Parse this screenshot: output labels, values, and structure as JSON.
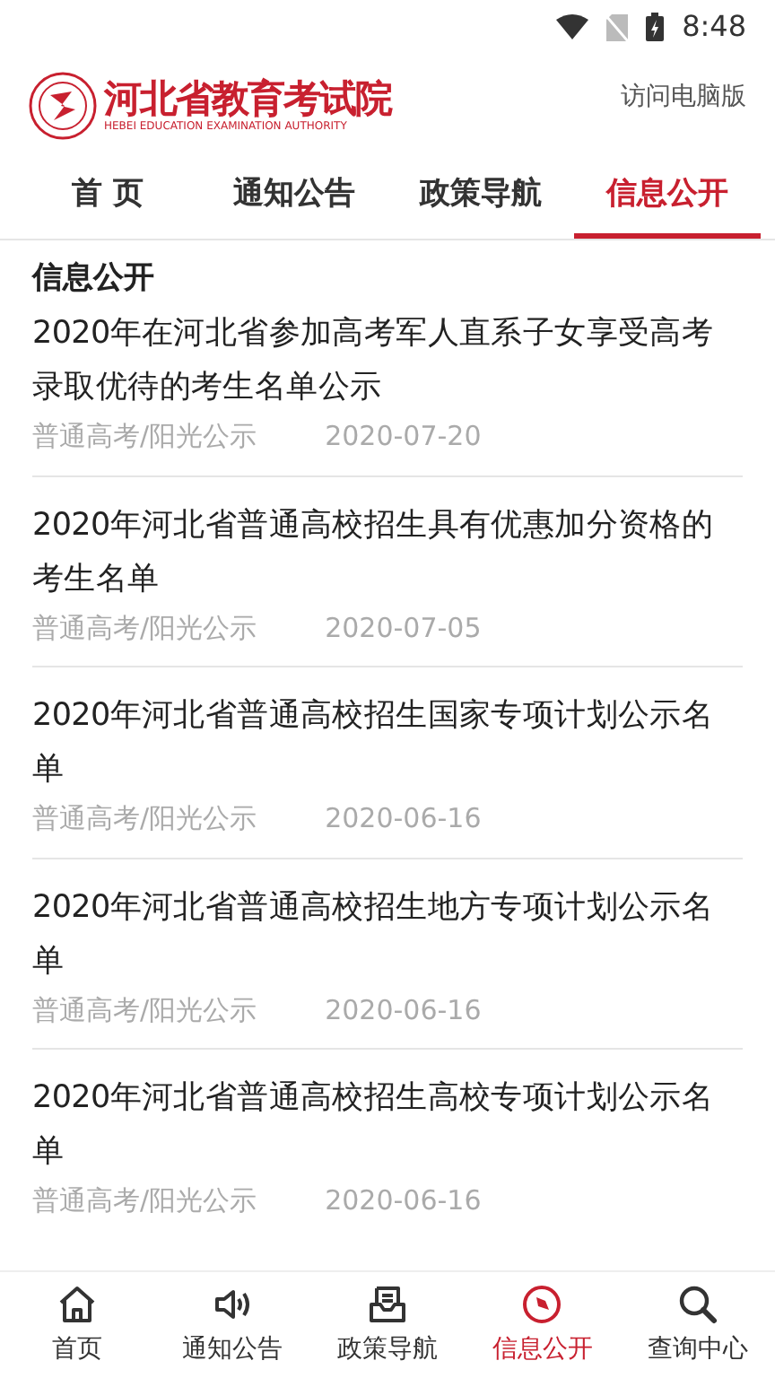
{
  "status_bar": {
    "time": "8:48"
  },
  "header": {
    "logo_title": "河北省教育考试院",
    "logo_subtitle": "HEBEI EDUCATION EXAMINATION AUTHORITY",
    "desktop_link": "访问电脑版"
  },
  "tabs": [
    {
      "label": "首 页",
      "selected": false
    },
    {
      "label": "通知公告",
      "selected": false
    },
    {
      "label": "政策导航",
      "selected": false
    },
    {
      "label": "信息公开",
      "selected": true
    }
  ],
  "section_title": "信息公开",
  "articles": [
    {
      "title": "2020年在河北省参加高考军人直系子女享受高考录取优待的考生名单公示",
      "category": "普通高考/阳光公示",
      "date": "2020-07-20"
    },
    {
      "title": "2020年河北省普通高校招生具有优惠加分资格的考生名单",
      "category": "普通高考/阳光公示",
      "date": "2020-07-05"
    },
    {
      "title": "2020年河北省普通高校招生国家专项计划公示名单",
      "category": "普通高考/阳光公示",
      "date": "2020-06-16"
    },
    {
      "title": "2020年河北省普通高校招生地方专项计划公示名单",
      "category": "普通高考/阳光公示",
      "date": "2020-06-16"
    },
    {
      "title": "2020年河北省普通高校招生高校专项计划公示名单",
      "category": "普通高考/阳光公示",
      "date": "2020-06-16"
    }
  ],
  "bottom_nav": [
    {
      "kind": "home",
      "label": "首页",
      "selected": false
    },
    {
      "kind": "speaker",
      "label": "通知公告",
      "selected": false
    },
    {
      "kind": "inbox",
      "label": "政策导航",
      "selected": false
    },
    {
      "kind": "compass",
      "label": "信息公开",
      "selected": true
    },
    {
      "kind": "search",
      "label": "查询中心",
      "selected": false
    }
  ]
}
